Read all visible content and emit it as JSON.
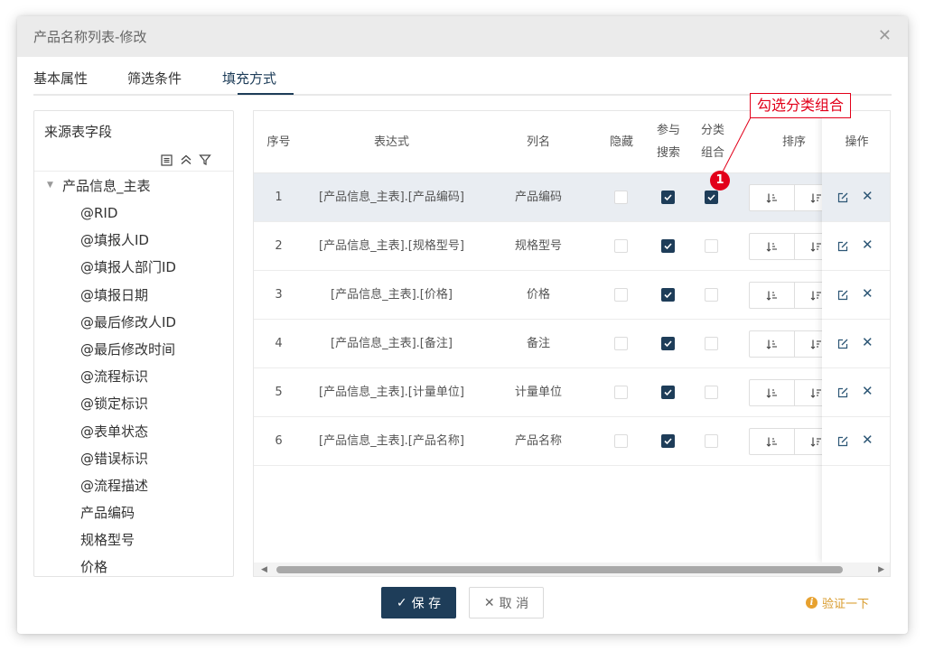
{
  "dialog": {
    "title": "产品名称列表-修改",
    "close_glyph": "✕"
  },
  "tabs": [
    {
      "label": "基本属性",
      "active": false
    },
    {
      "label": "筛选条件",
      "active": false
    },
    {
      "label": "填充方式",
      "active": true
    }
  ],
  "source_panel": {
    "title": "来源表字段",
    "tool_icons": [
      "list-icon",
      "collapse-up-icon",
      "filter-icon"
    ],
    "root": "产品信息_主表",
    "items": [
      "@RID",
      "@填报人ID",
      "@填报人部门ID",
      "@填报日期",
      "@最后修改人ID",
      "@最后修改时间",
      "@流程标识",
      "@锁定标识",
      "@表单状态",
      "@错误标识",
      "@流程描述",
      "产品编码",
      "规格型号",
      "价格"
    ]
  },
  "grid": {
    "headers": {
      "index": "序号",
      "expression": "表达式",
      "column_name": "列名",
      "hidden": "隐藏",
      "search_line1": "参与",
      "search_line2": "搜索",
      "category_line1": "分类",
      "category_line2": "组合",
      "sort": "排序",
      "ops": "操作"
    },
    "rows": [
      {
        "index": "1",
        "expression": "[产品信息_主表].[产品编码]",
        "column_name": "产品编码",
        "hidden": false,
        "search": true,
        "category": true,
        "selected": true
      },
      {
        "index": "2",
        "expression": "[产品信息_主表].[规格型号]",
        "column_name": "规格型号",
        "hidden": false,
        "search": true,
        "category": false,
        "selected": false
      },
      {
        "index": "3",
        "expression": "[产品信息_主表].[价格]",
        "column_name": "价格",
        "hidden": false,
        "search": true,
        "category": false,
        "selected": false
      },
      {
        "index": "4",
        "expression": "[产品信息_主表].[备注]",
        "column_name": "备注",
        "hidden": false,
        "search": true,
        "category": false,
        "selected": false
      },
      {
        "index": "5",
        "expression": "[产品信息_主表].[计量单位]",
        "column_name": "计量单位",
        "hidden": false,
        "search": true,
        "category": false,
        "selected": false
      },
      {
        "index": "6",
        "expression": "[产品信息_主表].[产品名称]",
        "column_name": "产品名称",
        "hidden": false,
        "search": true,
        "category": false,
        "selected": false
      }
    ]
  },
  "annotation": {
    "label": "勾选分类组合",
    "badge": "1",
    "color": "#e2001a"
  },
  "footer": {
    "save_label": "保 存",
    "save_glyph": "✓",
    "cancel_label": "取 消",
    "cancel_glyph": "✕",
    "verify_label": "验证一下",
    "verify_glyph": "i"
  },
  "colors": {
    "primary": "#1e3d59",
    "selected_row": "#e9edf2",
    "warning": "#e7a12f"
  }
}
